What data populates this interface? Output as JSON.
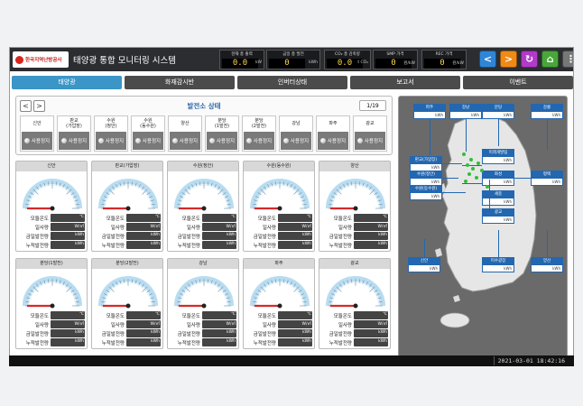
{
  "header": {
    "logo_text": "한국지역난방공사",
    "title": "태양광 통합 모니터링 시스템",
    "stats": [
      {
        "label": "현재 총 출력",
        "value": "0.0",
        "unit": "kW"
      },
      {
        "label": "금일 총 발전",
        "value": "0",
        "unit": "kWh"
      },
      {
        "label": "CO₂ 총 감축량",
        "value": "0.0",
        "unit": "t CO₂"
      },
      {
        "label": "SMP 가격",
        "value": "0",
        "unit": "원/kW"
      },
      {
        "label": "REC 가격",
        "value": "0",
        "unit": "원/kW"
      }
    ],
    "buttons": [
      {
        "name": "nav-back-button",
        "icon": "chevron-left-icon",
        "glyph": "<",
        "color": "#2f86d8"
      },
      {
        "name": "nav-forward-button",
        "icon": "chevron-right-icon",
        "glyph": ">",
        "color": "#f08a17"
      },
      {
        "name": "refresh-button",
        "icon": "refresh-icon",
        "glyph": "↻",
        "color": "#b23ac9"
      },
      {
        "name": "home-button",
        "icon": "home-icon",
        "glyph": "⌂",
        "color": "#49a63a"
      },
      {
        "name": "menu-button",
        "icon": "more-icon",
        "glyph": "⋮",
        "color": "#777777"
      }
    ]
  },
  "tabs": [
    {
      "label": "태양광",
      "active": true
    },
    {
      "label": "화재감시반",
      "active": false
    },
    {
      "label": "인버터상태",
      "active": false
    },
    {
      "label": "보고서",
      "active": false
    },
    {
      "label": "이벤트",
      "active": false
    }
  ],
  "status_panel": {
    "title": "발전소 상태",
    "page": "1/19",
    "prev": "<",
    "next": ">",
    "plants": [
      {
        "name": "신안",
        "status": "사용정지"
      },
      {
        "name": "판교\n(가압장)",
        "status": "사용정지"
      },
      {
        "name": "수원\n(정안)",
        "status": "사용정지"
      },
      {
        "name": "수원\n(동수원)",
        "status": "사용정지"
      },
      {
        "name": "양산",
        "status": "사용정지"
      },
      {
        "name": "분당\n(1발전)",
        "status": "사용정지"
      },
      {
        "name": "분당\n(2발전)",
        "status": "사용정지"
      },
      {
        "name": "강남",
        "status": "사용정지"
      },
      {
        "name": "파주",
        "status": "사용정지"
      },
      {
        "name": "광교",
        "status": "사용정지"
      }
    ]
  },
  "gauge_labels": {
    "temp": "모듈온도",
    "irradiance": "일사량",
    "today": "금일발전량",
    "total": "누적발전량"
  },
  "gauge_units": {
    "temp": "℃",
    "irradiance": "W/㎡",
    "today": "kWh",
    "total": "kWh"
  },
  "gauges": [
    {
      "title": "신안",
      "value": 0
    },
    {
      "title": "판교(가압장)",
      "value": 0
    },
    {
      "title": "수원(정안)",
      "value": 0
    },
    {
      "title": "수원(동수원)",
      "value": 0
    },
    {
      "title": "양산",
      "value": 0
    },
    {
      "title": "분당(1발전)",
      "value": 0
    },
    {
      "title": "분당(2발전)",
      "value": 0
    },
    {
      "title": "강남",
      "value": 0
    },
    {
      "title": "파주",
      "value": 0
    },
    {
      "title": "광교",
      "value": 0
    }
  ],
  "map": {
    "unit": "kWh",
    "labels": [
      {
        "name": "파주"
      },
      {
        "name": "강남"
      },
      {
        "name": "분당"
      },
      {
        "name": "강릉"
      },
      {
        "name": "판교(가압장)"
      },
      {
        "name": "미래개발팀"
      },
      {
        "name": "수원(정안)"
      },
      {
        "name": "화성"
      },
      {
        "name": "평택"
      },
      {
        "name": "수원(동수원)"
      },
      {
        "name": "세종"
      },
      {
        "name": "광교"
      },
      {
        "name": "신안"
      },
      {
        "name": "미수광장"
      },
      {
        "name": "양산"
      }
    ]
  },
  "footer": {
    "datetime": "2021-03-01  18:42:16"
  },
  "colors": {
    "accent": "#3b95c7",
    "gauge_red": "#d62a2a",
    "map_label": "#2367b0"
  }
}
